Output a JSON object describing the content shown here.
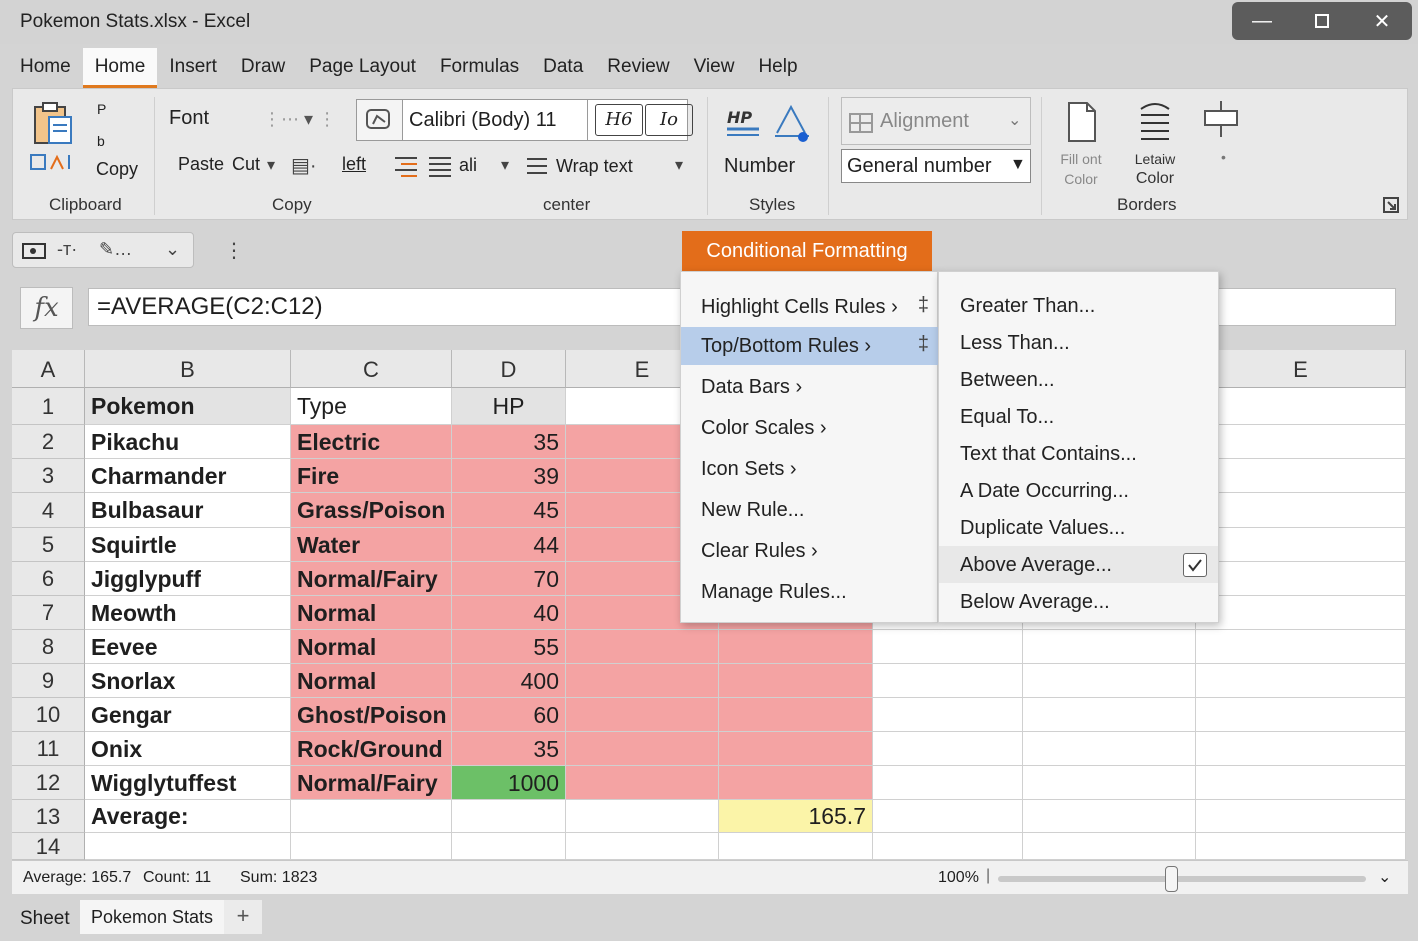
{
  "window": {
    "title": "Pokemon Stats.xlsx - Excel"
  },
  "tabs": [
    "Home",
    "Home",
    "Insert",
    "Draw",
    "Page Layout",
    "Formulas",
    "Data",
    "Review",
    "View",
    "Help"
  ],
  "ribbon": {
    "clipboard": {
      "p1": "P",
      "p2": "b",
      "copy": "Copy",
      "label": "Clipboard"
    },
    "font": {
      "font_label": "Font",
      "paste": "Paste",
      "cut": "Cut",
      "left": "left",
      "label": "Copy"
    },
    "fontbox": {
      "name": "Calibri (Body) 11",
      "btn1": "H6",
      "btn2": "Io"
    },
    "align": {
      "wrap": "Wrap text",
      "label": "center",
      "ali": "ali"
    },
    "styles": {
      "number": "Number",
      "label": "Styles",
      "icon1": "HP"
    },
    "alignment_dd": "Alignment",
    "number_dd": "General number",
    "borders": {
      "fill_l1": "Fill ont",
      "fill_l2": "Color",
      "let_l1": "Letaiw",
      "let_l2": "Color",
      "label": "Borders"
    }
  },
  "cf_header": "Conditional Formatting",
  "formula": {
    "fx": "fx",
    "text": "=AVERAGE(C2:C12)"
  },
  "columns": [
    "A",
    "B",
    "C",
    "D",
    "E",
    "E"
  ],
  "rows": [
    {
      "n": "1",
      "name": "Pokemon",
      "type": "Type",
      "hp": "HP"
    },
    {
      "n": "2",
      "name": "Pikachu",
      "type": "Electric",
      "hp": "35"
    },
    {
      "n": "3",
      "name": "Charmander",
      "type": "Fire",
      "hp": "39"
    },
    {
      "n": "4",
      "name": "Bulbasaur",
      "type": "Grass/Poison",
      "hp": "45"
    },
    {
      "n": "5",
      "name": "Squirtle",
      "type": "Water",
      "hp": "44"
    },
    {
      "n": "6",
      "name": "Jigglypuff",
      "type": "Normal/Fairy",
      "hp": "70"
    },
    {
      "n": "7",
      "name": "Meowth",
      "type": "Normal",
      "hp": "40"
    },
    {
      "n": "8",
      "name": "Eevee",
      "type": "Normal",
      "hp": "55"
    },
    {
      "n": "9",
      "name": "Snorlax",
      "type": "Normal",
      "hp": "400"
    },
    {
      "n": "10",
      "name": "Gengar",
      "type": "Ghost/Poison",
      "hp": "60"
    },
    {
      "n": "11",
      "name": "Onix",
      "type": "Rock/Ground",
      "hp": "35"
    },
    {
      "n": "12",
      "name": "Wigglytuffest",
      "type": "Normal/Fairy",
      "hp": "1000"
    },
    {
      "n": "13",
      "name": "Average:",
      "type": "",
      "hp": ""
    },
    {
      "n": "14",
      "name": "",
      "type": "",
      "hp": ""
    }
  ],
  "average_value": "165.7",
  "menu_main": [
    "Highlight Cells Rules ›",
    "Top/Bottom Rules ›",
    "Data Bars ›",
    "Color Scales ›",
    "Icon Sets ›",
    "New Rule...",
    "Clear Rules ›",
    "Manage Rules..."
  ],
  "menu_sub": [
    "Greater Than...",
    "Less Than...",
    "Between...",
    "Equal To...",
    "Text that Contains...",
    "A Date Occurring...",
    "Duplicate Values...",
    "Above Average...",
    "Below Average..."
  ],
  "status": {
    "average": "Average: 165.7",
    "count": "Count: 11",
    "sum": "Sum: 1823",
    "zoom": "100%",
    "zoom_fraction": 0.47
  },
  "sheets": {
    "label": "Sheet",
    "tab": "Pokemon Stats",
    "add": "+"
  },
  "colors": {
    "accent": "#e36d1a",
    "red_fill": "#f4a3a3",
    "green_fill": "#6cc067",
    "yellow_fill": "#fbf4a8",
    "menu_highlight": "#b7cdea"
  }
}
